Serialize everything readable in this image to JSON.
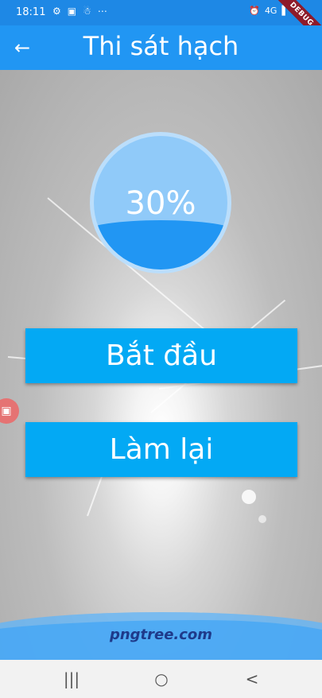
{
  "status_bar": {
    "time": "18:11",
    "left_icons": [
      "⚙",
      "▣",
      "☃",
      "⋯"
    ],
    "right_icons": [
      "⏰",
      "4G",
      "▌",
      "▮"
    ],
    "debug_label": "DEBUG"
  },
  "app_bar": {
    "back_icon": "←",
    "title": "Thi sát hạch"
  },
  "progress": {
    "label": "30%",
    "value": 0.3
  },
  "buttons": {
    "start_label": "Bắt đầu",
    "retry_label": "Làm lại"
  },
  "side_widget": {
    "icon": "▣"
  },
  "watermark": "pngtree.com",
  "nav_bar": {
    "recents_icon": "|||",
    "home_icon": "○",
    "back_icon": "<"
  },
  "colors": {
    "app_bar": "#2196F3",
    "status_bar": "#1E88E5",
    "button": "#03A9F4",
    "progress_fill": "#2196F3",
    "progress_bg": "#90CAF9"
  }
}
